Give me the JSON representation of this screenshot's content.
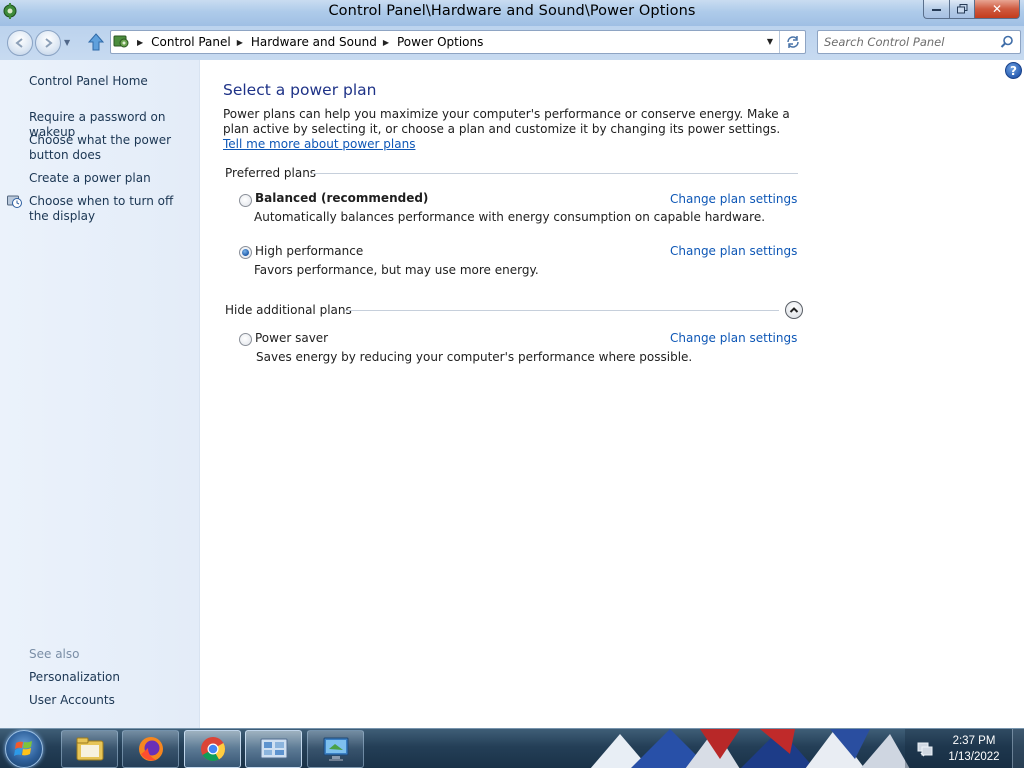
{
  "window": {
    "title": "Control Panel\\Hardware and Sound\\Power Options",
    "close_glyph": "✕"
  },
  "address_bar": {
    "breadcrumbs": [
      "Control Panel",
      "Hardware and Sound",
      "Power Options"
    ],
    "search_placeholder": "Search Control Panel"
  },
  "sidebar": {
    "home": "Control Panel Home",
    "links": [
      "Require a password on wakeup",
      "Choose what the power button does",
      "Create a power plan",
      "Choose when to turn off the display"
    ],
    "see_also_label": "See also",
    "see_also": [
      "Personalization",
      "User Accounts"
    ]
  },
  "main": {
    "title": "Select a power plan",
    "intro_text": "Power plans can help you maximize your computer's performance or conserve energy. Make a plan active by selecting it, or choose a plan and customize it by changing its power settings. ",
    "intro_link": "Tell me more about power plans",
    "help_glyph": "?",
    "preferred_label": "Preferred plans",
    "additional_label": "Hide additional plans",
    "plans": [
      {
        "name": "Balanced (recommended)",
        "description": "Automatically balances performance with energy consumption on capable hardware.",
        "link": "Change plan settings",
        "selected": false
      },
      {
        "name": "High performance",
        "description": "Favors performance, but may use more energy.",
        "link": "Change plan settings",
        "selected": true
      },
      {
        "name": "Power saver",
        "description": "Saves energy by reducing your computer's performance where possible.",
        "link": "Change plan settings",
        "selected": false
      }
    ]
  },
  "taskbar": {
    "time": "2:37 PM",
    "date": "1/13/2022",
    "apps": [
      "file-explorer-icon",
      "firefox-icon",
      "chrome-icon",
      "control-panel-icon",
      "remote-desktop-icon"
    ]
  },
  "colors": {
    "link": "#0e57b6",
    "title": "#1e3287",
    "sidebar_bg": "#e8f0fa"
  }
}
